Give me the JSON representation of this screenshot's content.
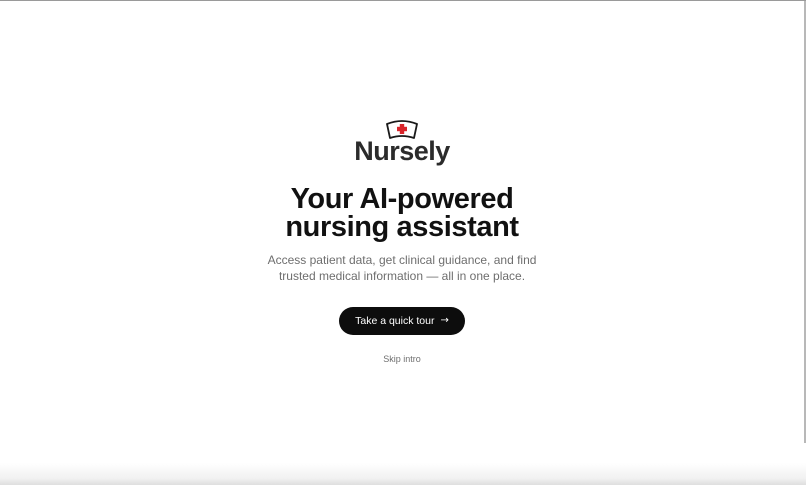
{
  "brand": {
    "name": "Nursely",
    "logo_icon": "nurse-cap-icon",
    "cross_color": "#d9252b"
  },
  "hero": {
    "headline_line1": "Your AI-powered",
    "headline_line2": "nursing assistant",
    "subtext_line1": "Access patient data, get clinical guidance, and find",
    "subtext_line2": "trusted medical information — all in one place."
  },
  "actions": {
    "tour_label": "Take a quick tour",
    "tour_icon": "arrow-right-icon",
    "skip_label": "Skip intro"
  },
  "colors": {
    "button_bg": "#0d0d0d",
    "text_primary": "#111111",
    "text_secondary": "#6e6e6e"
  }
}
